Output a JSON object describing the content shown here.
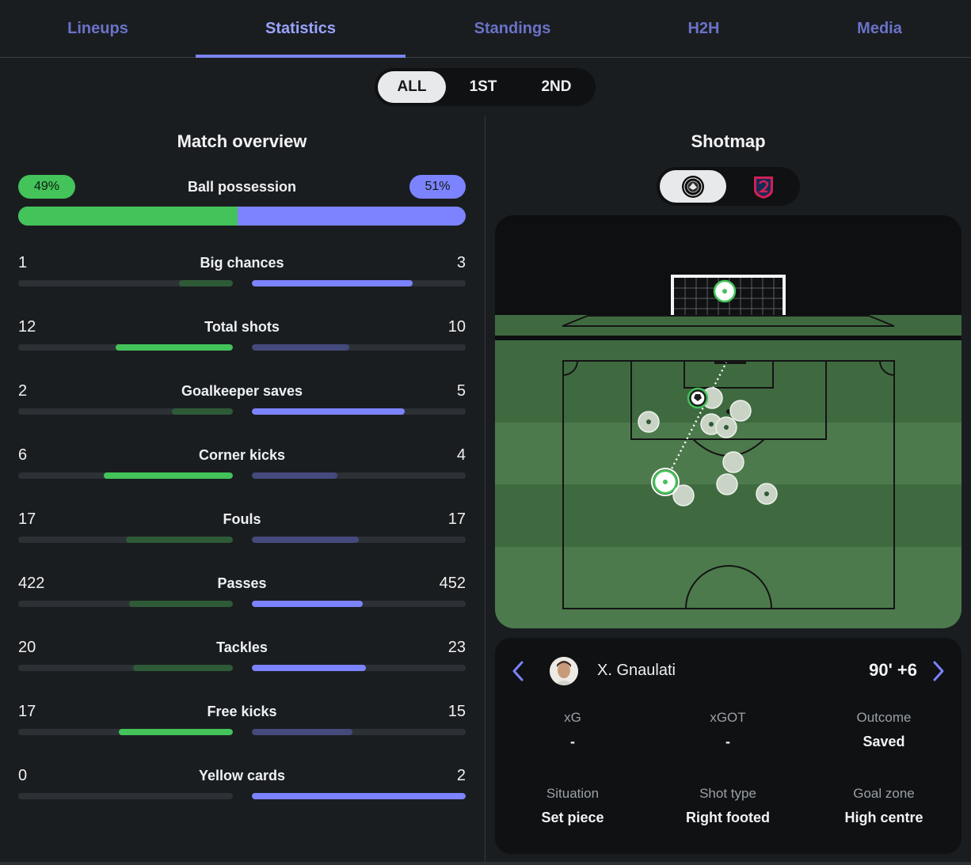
{
  "tabs": [
    {
      "label": "Lineups"
    },
    {
      "label": "Statistics"
    },
    {
      "label": "Standings"
    },
    {
      "label": "H2H"
    },
    {
      "label": "Media"
    }
  ],
  "active_tab": "Statistics",
  "period": {
    "options": [
      "ALL",
      "1ST",
      "2ND"
    ],
    "selected": "ALL"
  },
  "overview": {
    "title": "Match overview",
    "possession": {
      "label": "Ball possession",
      "home": "49%",
      "away": "51%",
      "home_value": 49,
      "away_value": 51
    },
    "stats": [
      {
        "label": "Big chances",
        "home": "1",
        "away": "3"
      },
      {
        "label": "Total shots",
        "home": "12",
        "away": "10"
      },
      {
        "label": "Goalkeeper saves",
        "home": "2",
        "away": "5"
      },
      {
        "label": "Corner kicks",
        "home": "6",
        "away": "4"
      },
      {
        "label": "Fouls",
        "home": "17",
        "away": "17"
      },
      {
        "label": "Passes",
        "home": "422",
        "away": "452"
      },
      {
        "label": "Tackles",
        "home": "20",
        "away": "23"
      },
      {
        "label": "Free kicks",
        "home": "17",
        "away": "15"
      },
      {
        "label": "Yellow cards",
        "home": "0",
        "away": "2"
      }
    ]
  },
  "shotmap": {
    "title": "Shotmap",
    "teams": [
      {
        "icon": "home-team-crest-icon"
      },
      {
        "icon": "away-team-crest-icon"
      }
    ],
    "selected_team": 0,
    "player": "X. Gnaulati",
    "minute": "90' +6",
    "details": [
      {
        "label": "xG",
        "value": "-"
      },
      {
        "label": "xGOT",
        "value": "-"
      },
      {
        "label": "Outcome",
        "value": "Saved"
      },
      {
        "label": "Situation",
        "value": "Set piece"
      },
      {
        "label": "Shot type",
        "value": "Right footed"
      },
      {
        "label": "Goal zone",
        "value": "High centre"
      }
    ]
  },
  "colors": {
    "home": "#43c35a",
    "away": "#7c83ff",
    "home_dim": "#2f5a37",
    "away_dim": "#454a7c",
    "pitch": "#3f6a40"
  }
}
